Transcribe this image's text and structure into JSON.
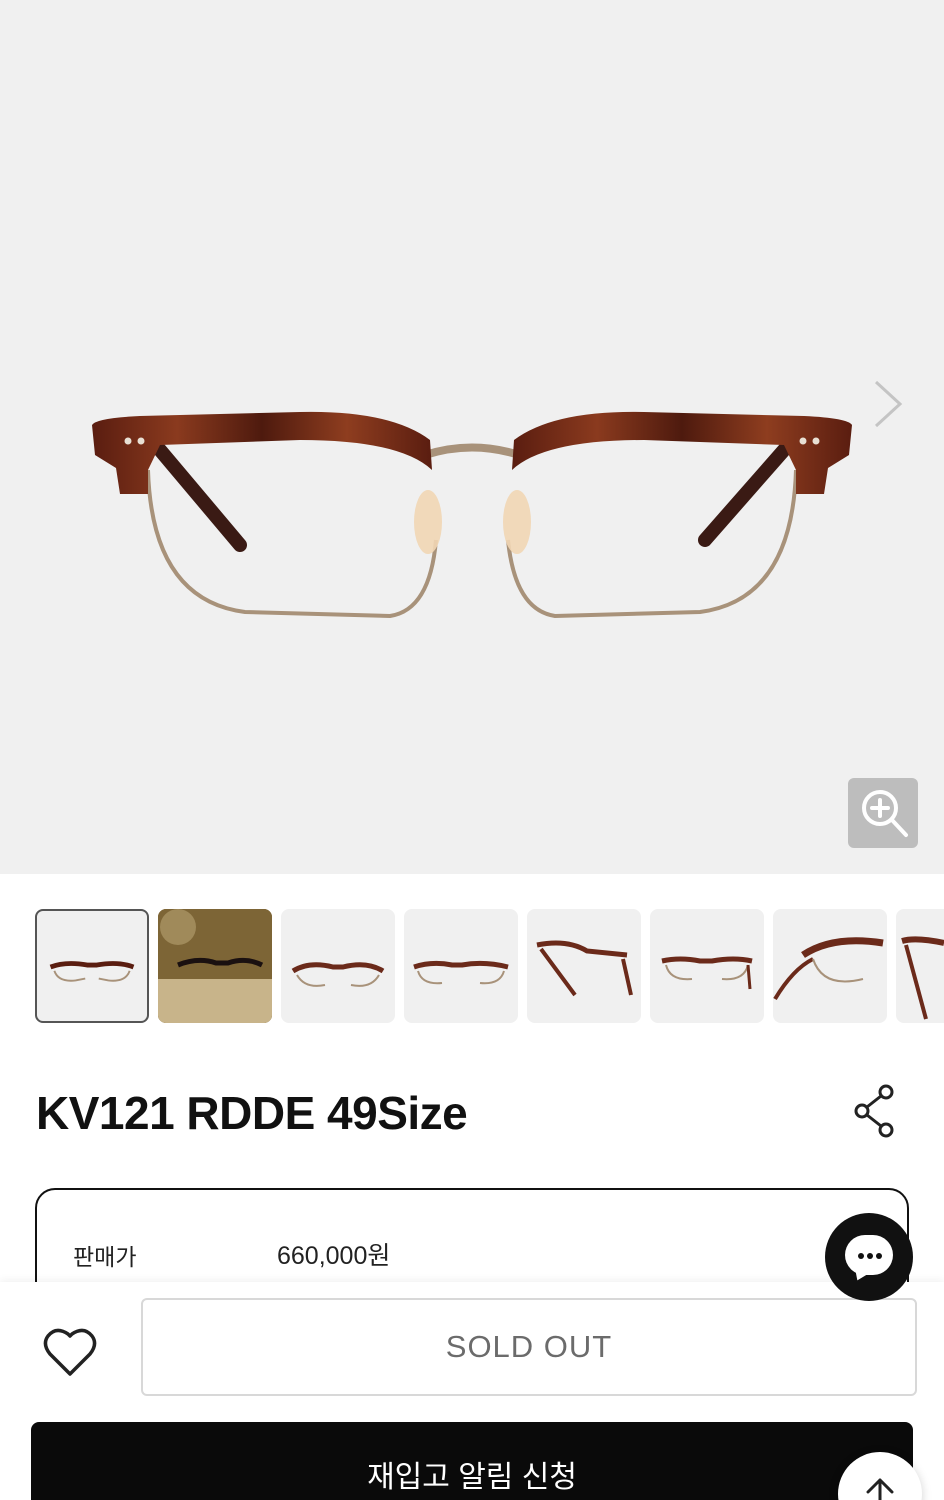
{
  "product": {
    "title": "KV121 RDDE 49Size",
    "price_label": "판매가",
    "price_value": "660,000원"
  },
  "gallery": {
    "thumbnail_count": 8,
    "active_index": 0
  },
  "actions": {
    "sold_out_label": "SOLD OUT",
    "restock_label": "재입고 알림 신청"
  },
  "icons": {
    "next": "chevron-right-icon",
    "zoom": "zoom-in-icon",
    "share": "share-icon",
    "chat": "chat-icon",
    "wishlist": "heart-icon",
    "scroll_top": "arrow-up-icon"
  },
  "colors": {
    "frame_tortoise": "#6b2a1a",
    "frame_gold": "#a8927a",
    "hero_bg": "#f0f0f0",
    "restock_bg": "#0a0a0a"
  }
}
